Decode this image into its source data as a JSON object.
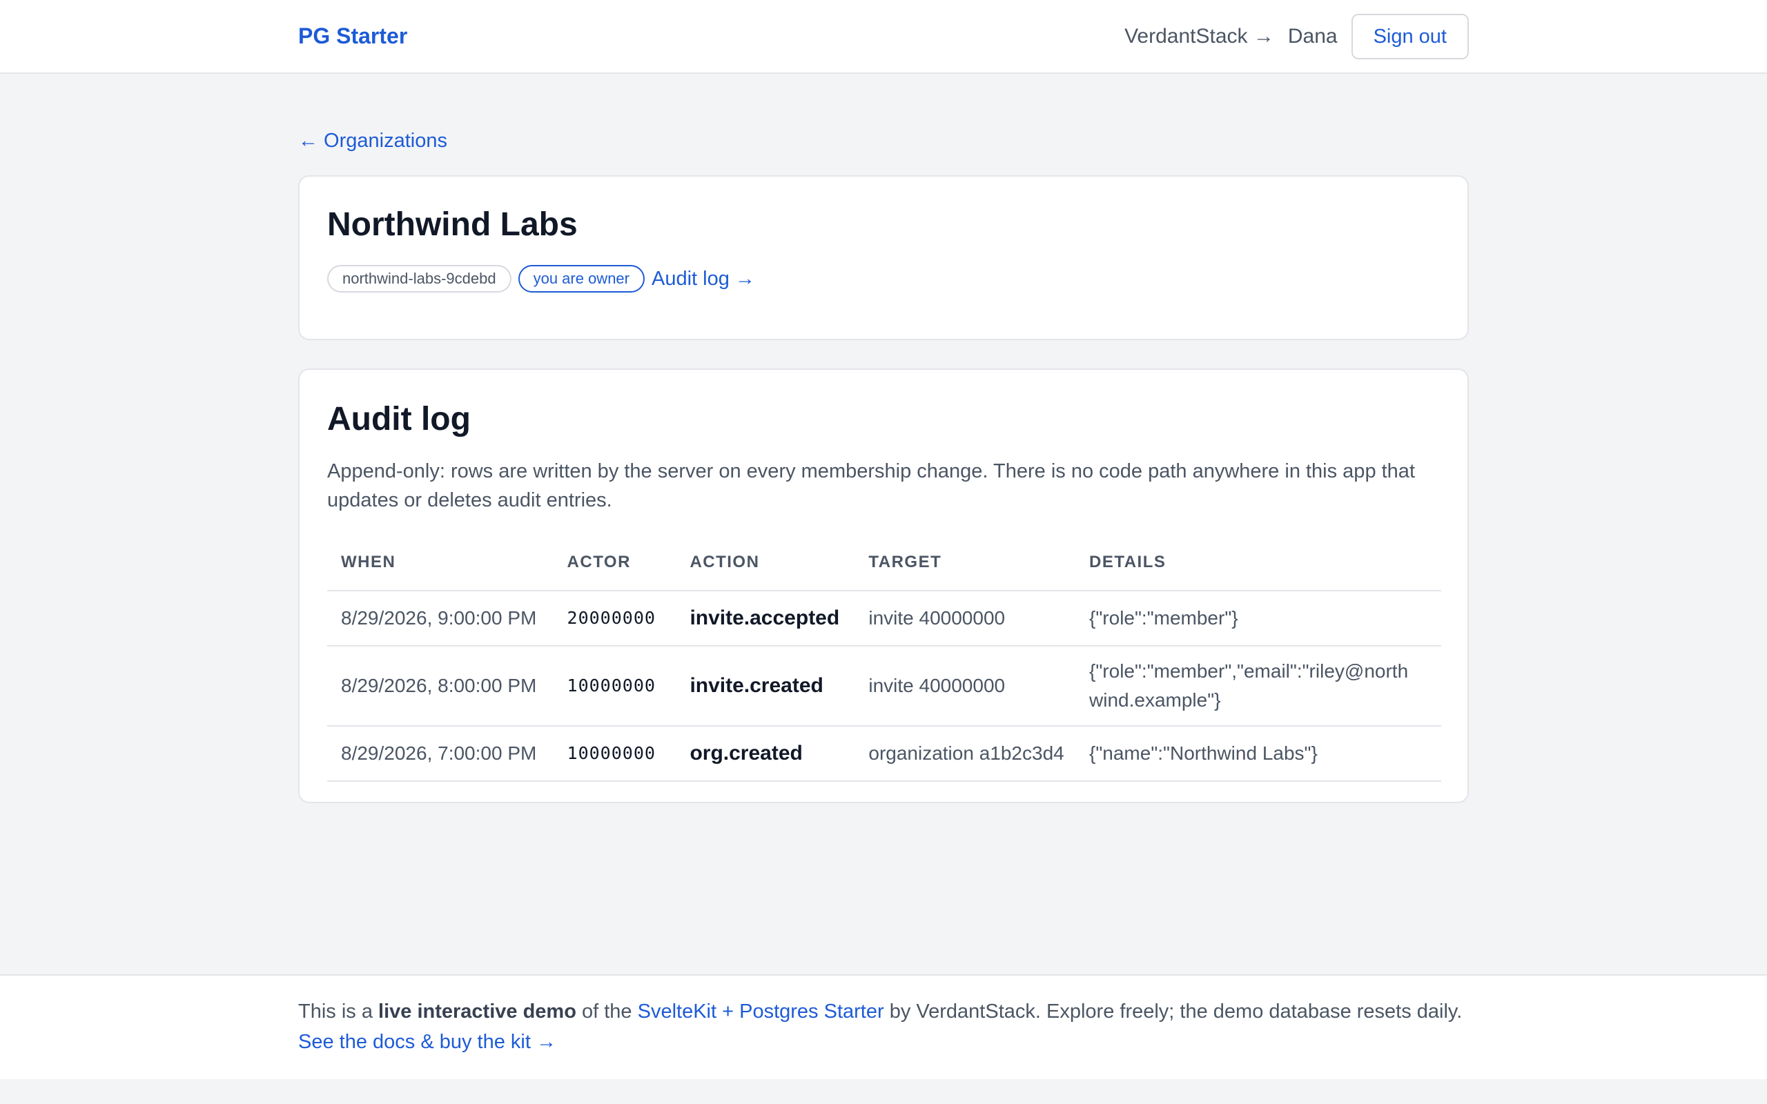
{
  "header": {
    "brand": "PG Starter",
    "org_switch": "VerdantStack →",
    "user": "Dana",
    "signout_label": "Sign out"
  },
  "nav": {
    "back_label": "← Organizations"
  },
  "org": {
    "name": "Northwind Labs",
    "slug": "northwind-labs-9cdebd",
    "role_badge": "you are owner",
    "audit_link": "Audit log →"
  },
  "audit": {
    "title": "Audit log",
    "description": "Append-only: rows are written by the server on every membership change. There is no code path anywhere in this app that updates or deletes audit entries.",
    "columns": [
      "WHEN",
      "ACTOR",
      "ACTION",
      "TARGET",
      "DETAILS"
    ],
    "rows": [
      {
        "when": "8/29/2026, 9:00:00 PM",
        "actor": "20000000",
        "action": "invite.accepted",
        "target": "invite 40000000",
        "details": "{\"role\":\"member\"}"
      },
      {
        "when": "8/29/2026, 8:00:00 PM",
        "actor": "10000000",
        "action": "invite.created",
        "target": "invite 40000000",
        "details": "{\"role\":\"member\",\"email\":\"riley@northwind.example\"}"
      },
      {
        "when": "8/29/2026, 7:00:00 PM",
        "actor": "10000000",
        "action": "org.created",
        "target": "organization a1b2c3d4",
        "details": "{\"name\":\"Northwind Labs\"}"
      }
    ]
  },
  "footer": {
    "prefix": "This is a ",
    "bold": "live interactive demo",
    "mid": " of the ",
    "link": "SvelteKit + Postgres Starter",
    "suffix": " by VerdantStack. Explore freely; the demo database resets daily.",
    "cta": "See the docs & buy the kit →"
  }
}
